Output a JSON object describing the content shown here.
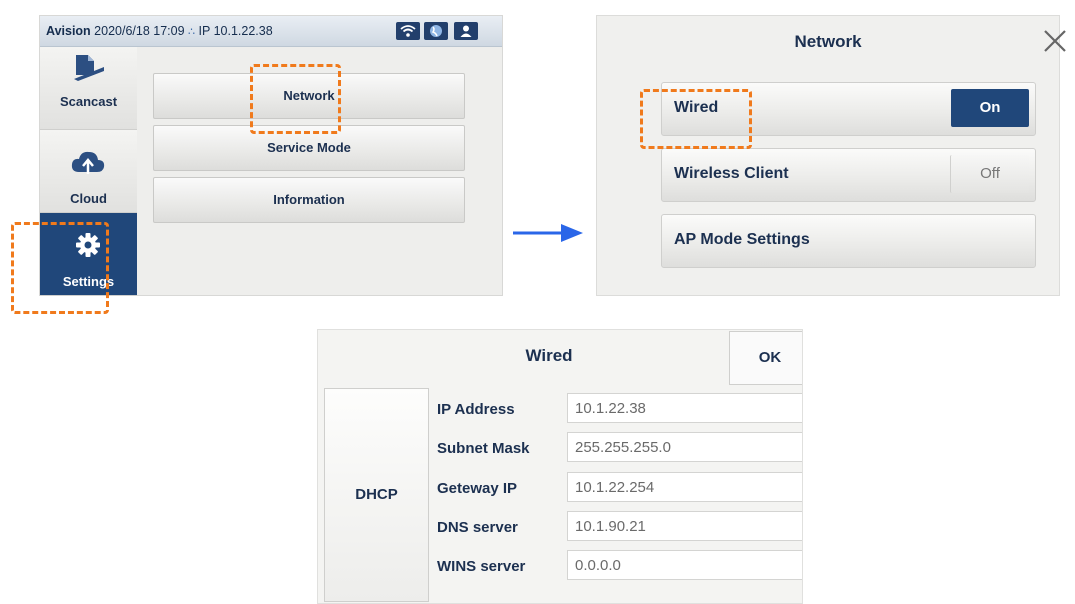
{
  "panel1": {
    "status": {
      "brand": "Avision",
      "datetime": "2020/6/18 17:09",
      "ip_label": "IP 10.1.22.38"
    },
    "nav": [
      {
        "label": "Scancast",
        "icon": "scancast-icon"
      },
      {
        "label": "Cloud",
        "icon": "cloud-upload-icon"
      },
      {
        "label": "Settings",
        "icon": "gear-icon",
        "active": true
      }
    ],
    "menu": [
      {
        "label": "Network"
      },
      {
        "label": "Service Mode"
      },
      {
        "label": "Information"
      }
    ]
  },
  "panel2": {
    "title": "Network",
    "rows": [
      {
        "label": "Wired",
        "toggle": "On"
      },
      {
        "label": "Wireless Client",
        "toggle": "Off"
      },
      {
        "label": "AP Mode Settings"
      }
    ]
  },
  "panel3": {
    "title": "Wired",
    "ok_label": "OK",
    "dhcp_label": "DHCP",
    "fields": [
      {
        "label": "IP Address",
        "value": "10.1.22.38"
      },
      {
        "label": "Subnet Mask",
        "value": "255.255.255.0"
      },
      {
        "label": "Geteway IP",
        "value": "10.1.22.254"
      },
      {
        "label": "DNS server",
        "value": "10.1.90.21"
      },
      {
        "label": "WINS server",
        "value": "0.0.0.0"
      }
    ]
  },
  "colors": {
    "accent": "#20477a",
    "highlight": "#f07a1c",
    "arrow": "#2a66e8"
  }
}
